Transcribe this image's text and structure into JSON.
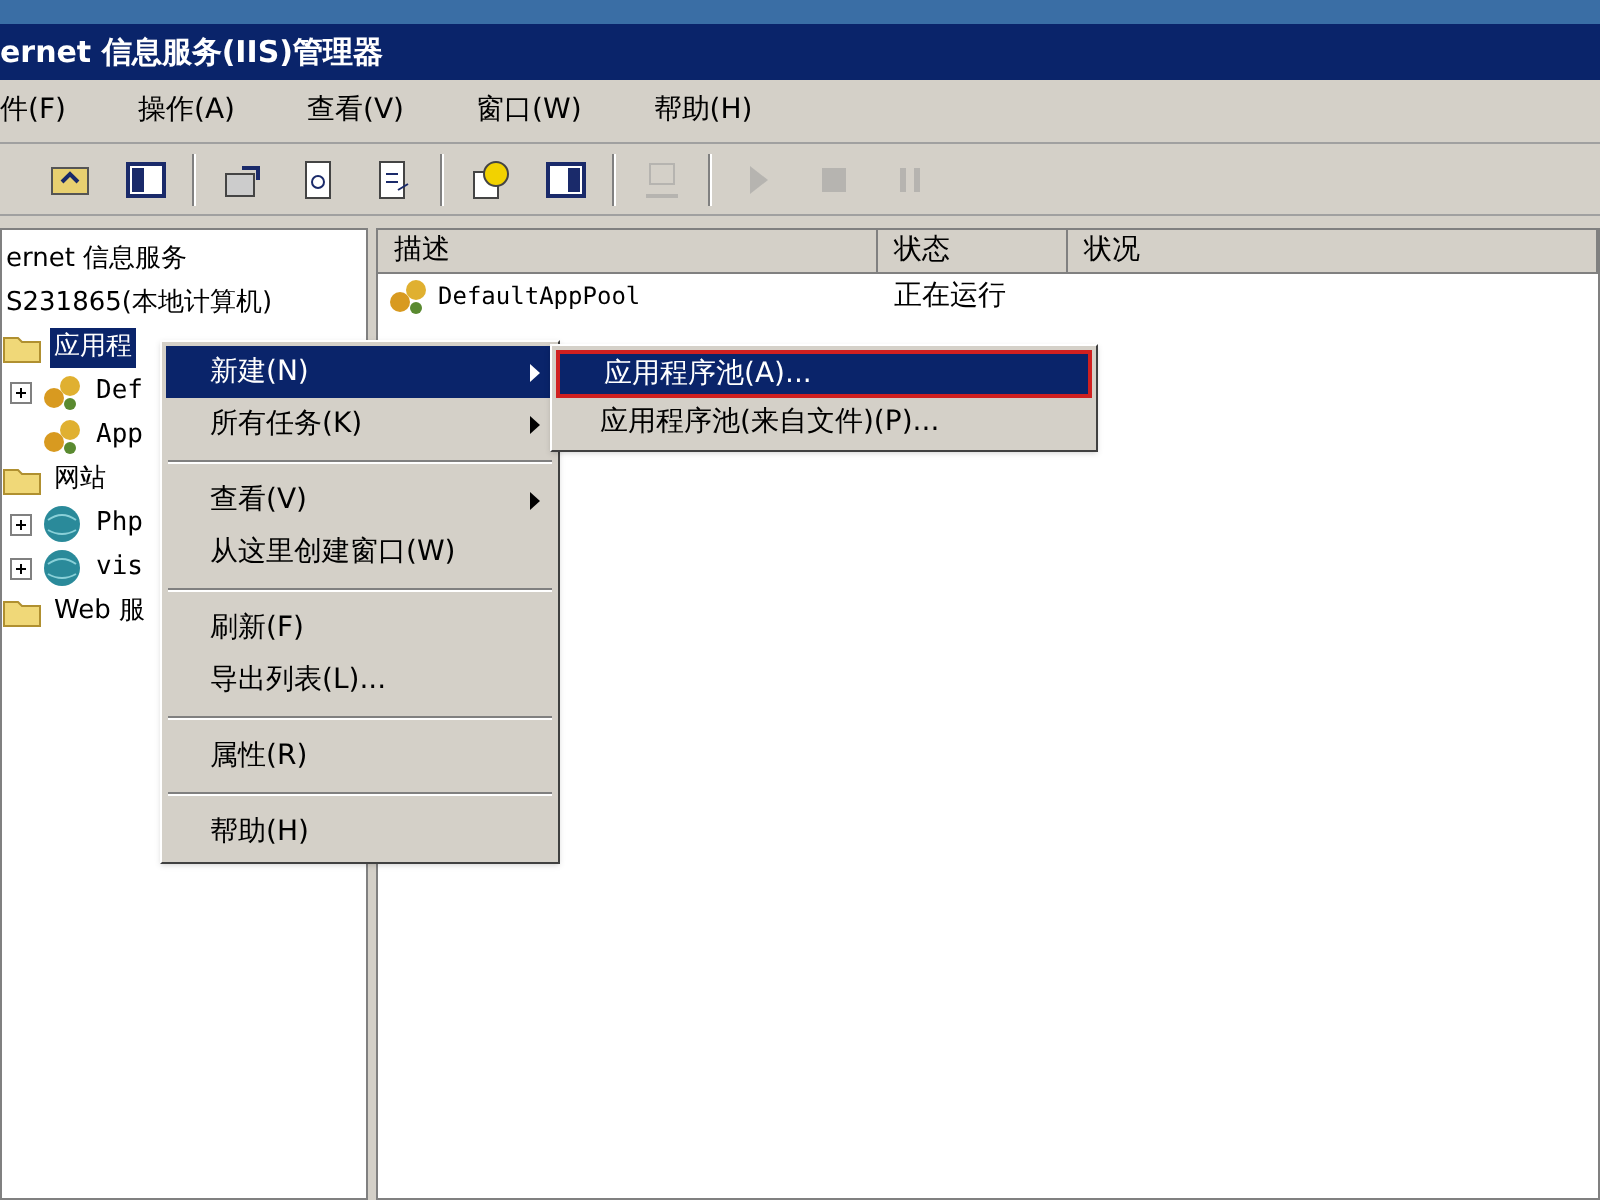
{
  "window": {
    "title": "ernet 信息服务(IIS)管理器"
  },
  "menu_bar": [
    "件(F)",
    "操作(A)",
    "查看(V)",
    "窗口(W)",
    "帮助(H)"
  ],
  "toolbar": [
    {
      "disabled": false
    },
    {
      "disabled": false
    },
    {
      "disabled": false
    },
    {
      "disabled": false
    },
    {
      "disabled": false
    },
    {
      "disabled": false
    },
    {
      "disabled": false
    },
    {
      "disabled": true
    },
    {
      "disabled": true
    },
    {
      "disabled": true
    },
    {
      "disabled": true
    }
  ],
  "tree": [
    {
      "label": "ernet 信息服务",
      "children": [
        {
          "label": "S231865(本地计算机)",
          "children": [
            {
              "label": "应用程",
              "selected": true,
              "children": [
                {
                  "label": "Def",
                  "expanded": false
                },
                {
                  "label": "App"
                }
              ]
            },
            {
              "label": "网站",
              "selected": false,
              "children": [
                {
                  "label": "Php",
                  "expanded": false
                },
                {
                  "label": "vis",
                  "expanded": false
                }
              ]
            },
            {
              "label": "Web 服",
              "selected": false
            }
          ]
        }
      ]
    }
  ],
  "table": {
    "columns": [
      "描述",
      "状态",
      "状况"
    ],
    "rows": [
      {
        "cells": [
          "DefaultAppPool",
          "正在运行"
        ]
      }
    ]
  },
  "context_menu": {
    "items": [
      {
        "kind": "item",
        "label": "新建(N)",
        "submenu": true,
        "selected": true
      },
      {
        "kind": "item",
        "label": "所有任务(K)",
        "submenu": true,
        "selected": false
      },
      {
        "kind": "separator"
      },
      {
        "kind": "item",
        "label": "查看(V)",
        "submenu": true,
        "selected": false
      },
      {
        "kind": "item",
        "label": "从这里创建窗口(W)",
        "submenu": false,
        "selected": false
      },
      {
        "kind": "separator"
      },
      {
        "kind": "item",
        "label": "刷新(F)",
        "submenu": false,
        "selected": false
      },
      {
        "kind": "item",
        "label": "导出列表(L)...",
        "submenu": false,
        "selected": false
      },
      {
        "kind": "separator"
      },
      {
        "kind": "item",
        "label": "属性(R)",
        "submenu": false,
        "selected": false
      },
      {
        "kind": "separator"
      },
      {
        "kind": "item",
        "label": "帮助(H)",
        "submenu": false,
        "selected": false
      }
    ]
  },
  "submenu": {
    "items": [
      {
        "label": "应用程序池(A)...",
        "selected": true
      },
      {
        "label": "应用程序池(来自文件)(P)...",
        "selected": false
      }
    ]
  }
}
